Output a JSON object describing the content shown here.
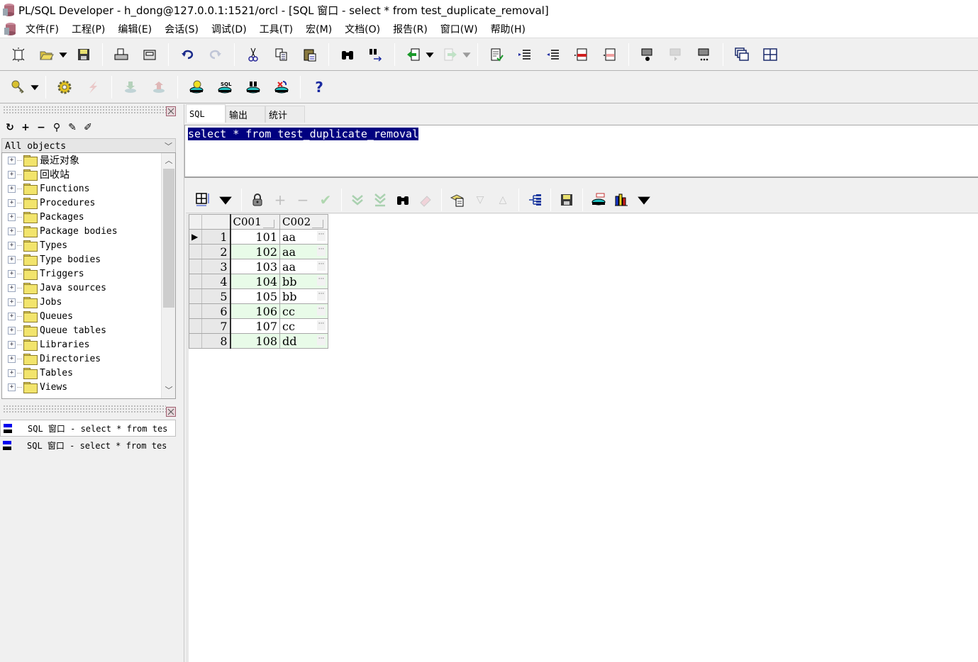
{
  "titlebar": {
    "title": "PL/SQL Developer - h_dong@127.0.0.1:1521/orcl - [SQL 窗口 - select * from test_duplicate_removal]"
  },
  "menubar": {
    "items": [
      "文件(F)",
      "工程(P)",
      "编辑(E)",
      "会话(S)",
      "调试(D)",
      "工具(T)",
      "宏(M)",
      "文档(O)",
      "报告(R)",
      "窗口(W)",
      "帮助(H)"
    ]
  },
  "toolbar_main": {
    "icons": [
      "new-icon",
      "open-icon",
      "save-icon",
      "print-icon",
      "print-preview-icon",
      "undo-icon",
      "redo-icon",
      "cut-icon",
      "copy-icon",
      "paste-icon",
      "find-icon",
      "find-next-icon",
      "indent-back-icon",
      "indent-forward-icon",
      "syntax-check-icon",
      "indent-icon",
      "unindent-icon",
      "comment-icon",
      "uncomment-icon",
      "macro-record-icon",
      "macro-play-icon",
      "macro-library-icon",
      "cascade-windows-icon",
      "tile-windows-icon"
    ]
  },
  "toolbar_session": {
    "icons": [
      "key-icon",
      "execute-icon",
      "break-icon",
      "commit-icon",
      "rollback-icon",
      "db-explain-icon",
      "db-sql-icon",
      "db-find-icon",
      "db-disconnect-icon",
      "help-icon"
    ],
    "help_label": "?"
  },
  "object_browser": {
    "filter": "All objects",
    "tree": [
      "最近对象",
      "回收站",
      "Functions",
      "Procedures",
      "Packages",
      "Package bodies",
      "Types",
      "Type bodies",
      "Triggers",
      "Java sources",
      "Jobs",
      "Queues",
      "Queue tables",
      "Libraries",
      "Directories",
      "Tables",
      "Views"
    ]
  },
  "window_list": {
    "items": [
      "SQL 窗口 - select * from tes",
      "SQL 窗口 - select * from tes"
    ]
  },
  "sql_window": {
    "tabs": [
      "SQL",
      "输出",
      "统计"
    ],
    "active_tab": "SQL",
    "sql_text": "select * from test_duplicate_removal"
  },
  "result_grid": {
    "columns": [
      "C001",
      "C002"
    ],
    "rows": [
      {
        "n": "1",
        "c001": "101",
        "c002": "aa"
      },
      {
        "n": "2",
        "c001": "102",
        "c002": "aa"
      },
      {
        "n": "3",
        "c001": "103",
        "c002": "aa"
      },
      {
        "n": "4",
        "c001": "104",
        "c002": "bb"
      },
      {
        "n": "5",
        "c001": "105",
        "c002": "bb"
      },
      {
        "n": "6",
        "c001": "106",
        "c002": "cc"
      },
      {
        "n": "7",
        "c001": "107",
        "c002": "cc"
      },
      {
        "n": "8",
        "c001": "108",
        "c002": "dd"
      }
    ],
    "current_row": 1,
    "ellipsis": "···",
    "row_indicator": "▶"
  },
  "colors": {
    "selection": "#000080",
    "alt_row": "#e8fbe8"
  }
}
